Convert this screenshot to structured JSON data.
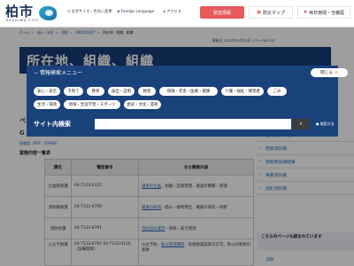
{
  "header": {
    "logo_text": "柏市",
    "logo_sub": "KASHIWA CITY",
    "links": [
      {
        "icon": "globe-icon",
        "label": "文字サイズ・色合い変更"
      },
      {
        "icon": "language-icon",
        "label": "Foreign Language"
      },
      {
        "icon": "access-icon",
        "label": "アクセス"
      }
    ],
    "emergency_label": "緊急情報",
    "map_label": "防災マップ",
    "holiday_label": "休日夜間・当番医"
  },
  "breadcrumb": {
    "items": [
      "ホーム",
      "安心・安全",
      "消防",
      "消防局の紹介"
    ],
    "current": "所在地、組織、組織"
  },
  "updated": "更新日 2022年10月25日 | ページID 132",
  "page_title": "所在地、組織、組織",
  "side_glyphs": [
    "ペ",
    "G"
  ],
  "left_link": "組織図（PDF：359KB）",
  "section_heading": "業務内容一覧表",
  "table": {
    "headers": [
      "課名",
      "電話番号",
      "主な業務内容"
    ],
    "rows": [
      {
        "name": "企画総務課",
        "phone": "04-7133-0115",
        "pre": "",
        "link": "施策の企画",
        "post": "、組織・定員管理、施設の整備・管理"
      },
      {
        "name": "消防職員課",
        "phone": "04-7133-8798",
        "pre": "",
        "link": "職員の採用",
        "post": "、給与・福利厚生、職員の育成・研修"
      },
      {
        "name": "消防防課",
        "phone": "04-7133-8791",
        "pre": "",
        "link": "消防団の運営",
        "post": "・研修・安全管理"
      },
      {
        "name": "火災予防課",
        "phone": "04-7133-8792 04-7133-0116（設備関係）",
        "pre": "火災予防、",
        "link": "防火管理講習",
        "post": "、危険物施設等の許可、防火対象物の査察"
      }
    ]
  },
  "sidebar": {
    "items": [
      "柏消防PR映像",
      "西部消防署",
      "救助隊訓練結果",
      "東部消防署",
      "旭町消防署"
    ],
    "more_heading": "こちらのページも読まれています",
    "after_item": "消防"
  },
  "overlay": {
    "panel_title": "情報検索メニュー",
    "close_label": "閉じる",
    "chips_row1": [
      "安心・安全",
      "子育て",
      "教育",
      "届出・証明",
      "税金",
      "保険・年金・医療・健康",
      "介護・福祉・障害者",
      "ごみ"
    ],
    "chips_row2": [
      "生活・環境",
      "地域・生涯学習・スポーツ",
      "歴史・文化・芸術"
    ],
    "search_label": "サイト内検索",
    "search_placeholder": "",
    "search_hint": "検索方法"
  },
  "colors": {
    "panel_bg": "#19427b",
    "emergency": "#e85a5a",
    "link": "#2a6bb3",
    "title_band": "#163d74"
  }
}
